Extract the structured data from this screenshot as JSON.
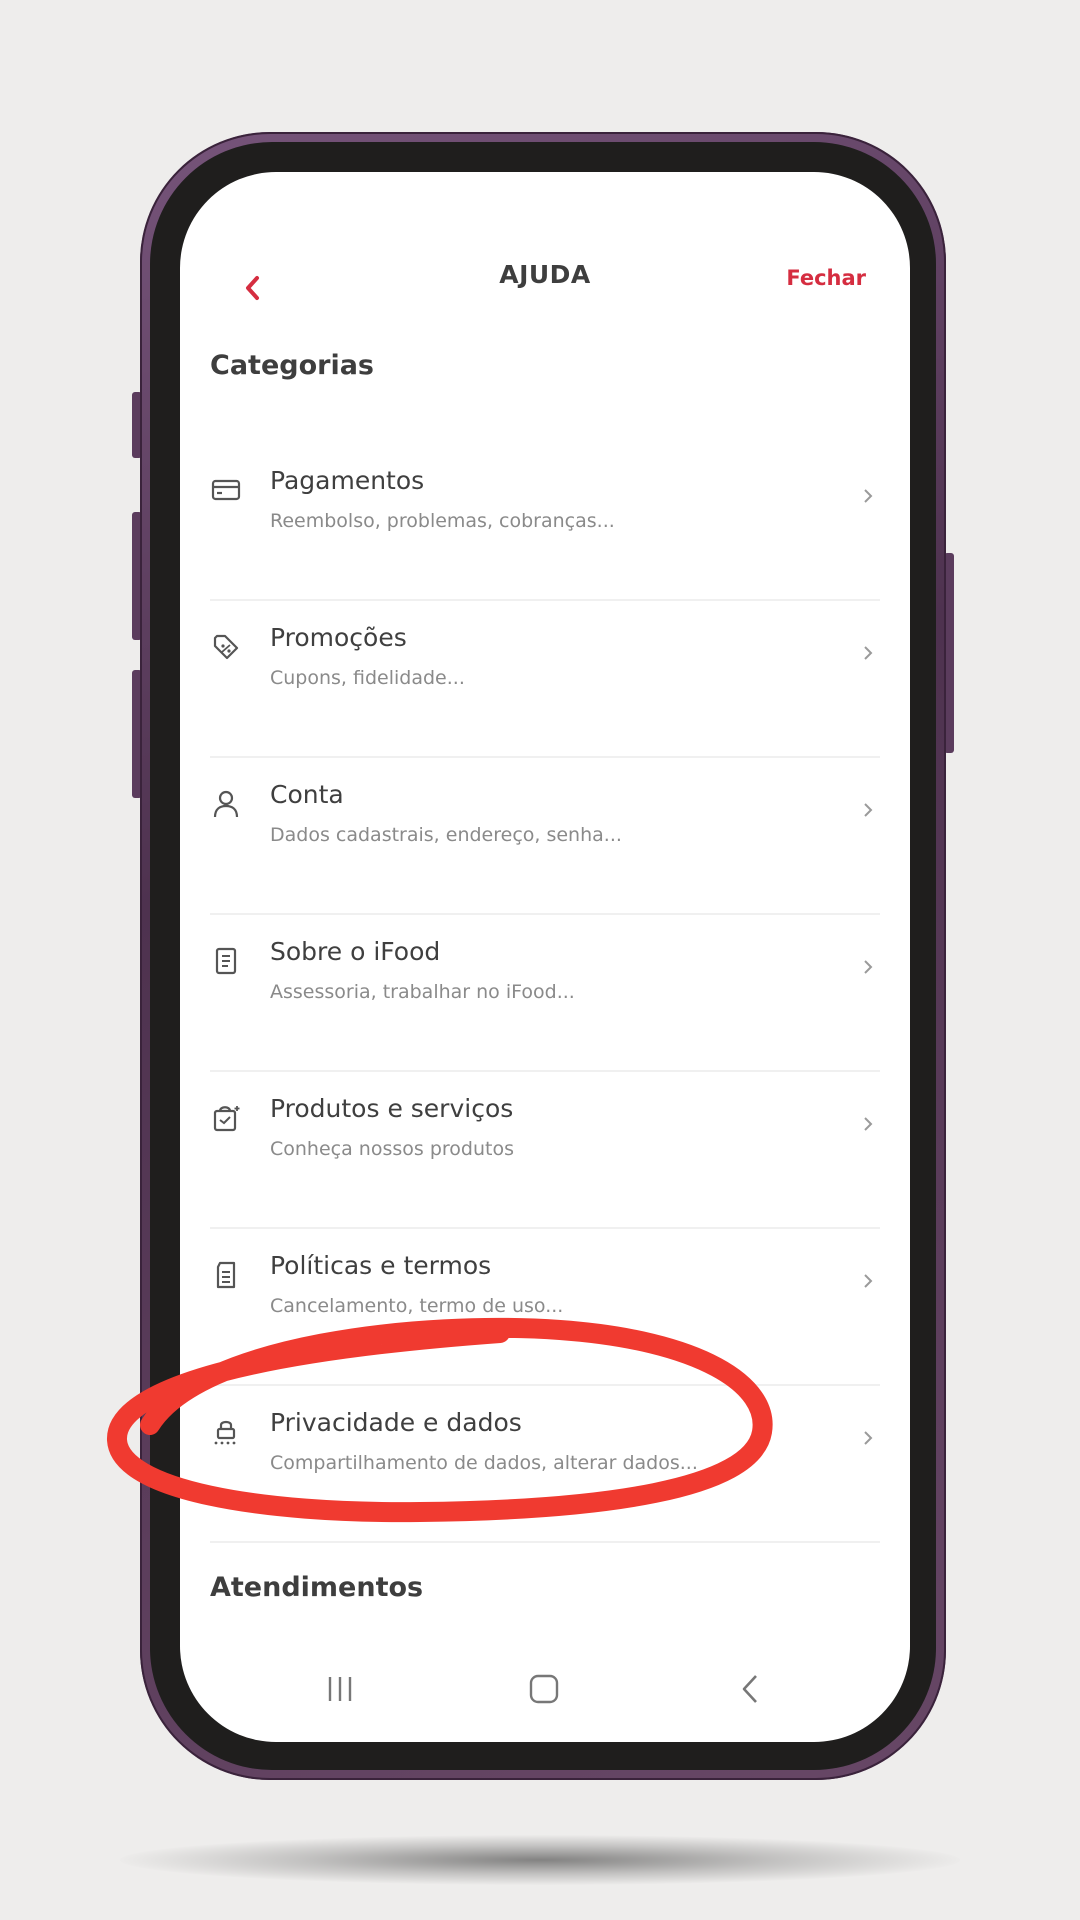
{
  "header": {
    "title": "AJUDA",
    "close_label": "Fechar"
  },
  "sections": {
    "categories_title": "Categorias",
    "services_title": "Atendimentos"
  },
  "categories": [
    {
      "icon": "credit-card-icon",
      "title": "Pagamentos",
      "subtitle": "Reembolso, problemas, cobranças..."
    },
    {
      "icon": "discount-tag-icon",
      "title": "Promoções",
      "subtitle": "Cupons, fidelidade..."
    },
    {
      "icon": "user-icon",
      "title": "Conta",
      "subtitle": "Dados cadastrais, endereço, senha..."
    },
    {
      "icon": "document-icon",
      "title": "Sobre o iFood",
      "subtitle": "Assessoria, trabalhar no iFood..."
    },
    {
      "icon": "shopping-bag-icon",
      "title": "Produtos e serviços",
      "subtitle": "Conheça nossos produtos"
    },
    {
      "icon": "policy-document-icon",
      "title": "Políticas e termos",
      "subtitle": "Cancelamento, termo de uso..."
    },
    {
      "icon": "lock-icon",
      "title": "Privacidade e dados",
      "subtitle": "Compartilhamento de dados, alterar dados..."
    }
  ],
  "colors": {
    "accent": "#d52d40",
    "annotation": "#f03a30",
    "phone_frame": "#5b3c5d"
  }
}
